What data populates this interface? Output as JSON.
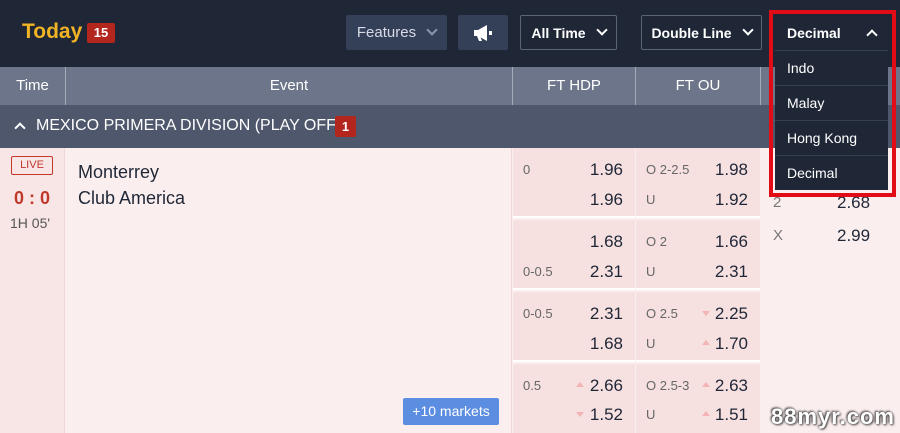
{
  "topbar": {
    "today_label": "Today",
    "today_count": "15",
    "features_label": "Features",
    "time_filter": "All Time",
    "line_mode": "Double Line",
    "odds_format": "Decimal"
  },
  "dropdown": {
    "options": [
      "Indo",
      "Malay",
      "Hong Kong",
      "Decimal"
    ]
  },
  "columns": [
    "Time",
    "Event",
    "FT HDP",
    "FT OU",
    ""
  ],
  "league": {
    "name": "MEXICO PRIMERA DIVISION (PLAY OFF)",
    "count": "1"
  },
  "match": {
    "status": "LIVE",
    "score": "0 : 0",
    "clock": "1H 05'",
    "home": "Monterrey",
    "away": "Club America",
    "more_markets": "+10 markets",
    "lines": [
      {
        "hdp_home": "0",
        "hdp_away": "",
        "hdp_home_odds": "1.96",
        "hdp_away_odds": "1.96",
        "ou_over": "O 2-2.5",
        "ou_under": "U",
        "ou_over_odds": "1.98",
        "ou_under_odds": "1.92"
      },
      {
        "hdp_home": "",
        "hdp_away": "0-0.5",
        "hdp_home_odds": "1.68",
        "hdp_away_odds": "2.31",
        "ou_over": "O 2",
        "ou_under": "U",
        "ou_over_odds": "1.66",
        "ou_under_odds": "2.31"
      },
      {
        "hdp_home": "0-0.5",
        "hdp_away": "",
        "hdp_home_odds": "2.31",
        "hdp_away_odds": "1.68",
        "ou_over": "O 2.5",
        "ou_under": "U",
        "ou_over_odds": "2.25",
        "ou_under_odds": "1.70"
      },
      {
        "hdp_home": "0.5",
        "hdp_away": "",
        "hdp_home_odds": "2.66",
        "hdp_away_odds": "1.52",
        "ou_over": "O 2.5-3",
        "ou_under": "U",
        "ou_over_odds": "2.63",
        "ou_under_odds": "1.51"
      }
    ],
    "onextwo": [
      {
        "label": "2",
        "odds": "2.68"
      },
      {
        "label": "X",
        "odds": "2.99"
      }
    ]
  },
  "watermark": "88myr.com",
  "colors": {
    "topbar_bg": "#1f2737",
    "today_accent": "#f0b323",
    "badge_red": "#b3261e",
    "highlight_red": "#e20c16",
    "markets_button": "#5b8de0"
  }
}
